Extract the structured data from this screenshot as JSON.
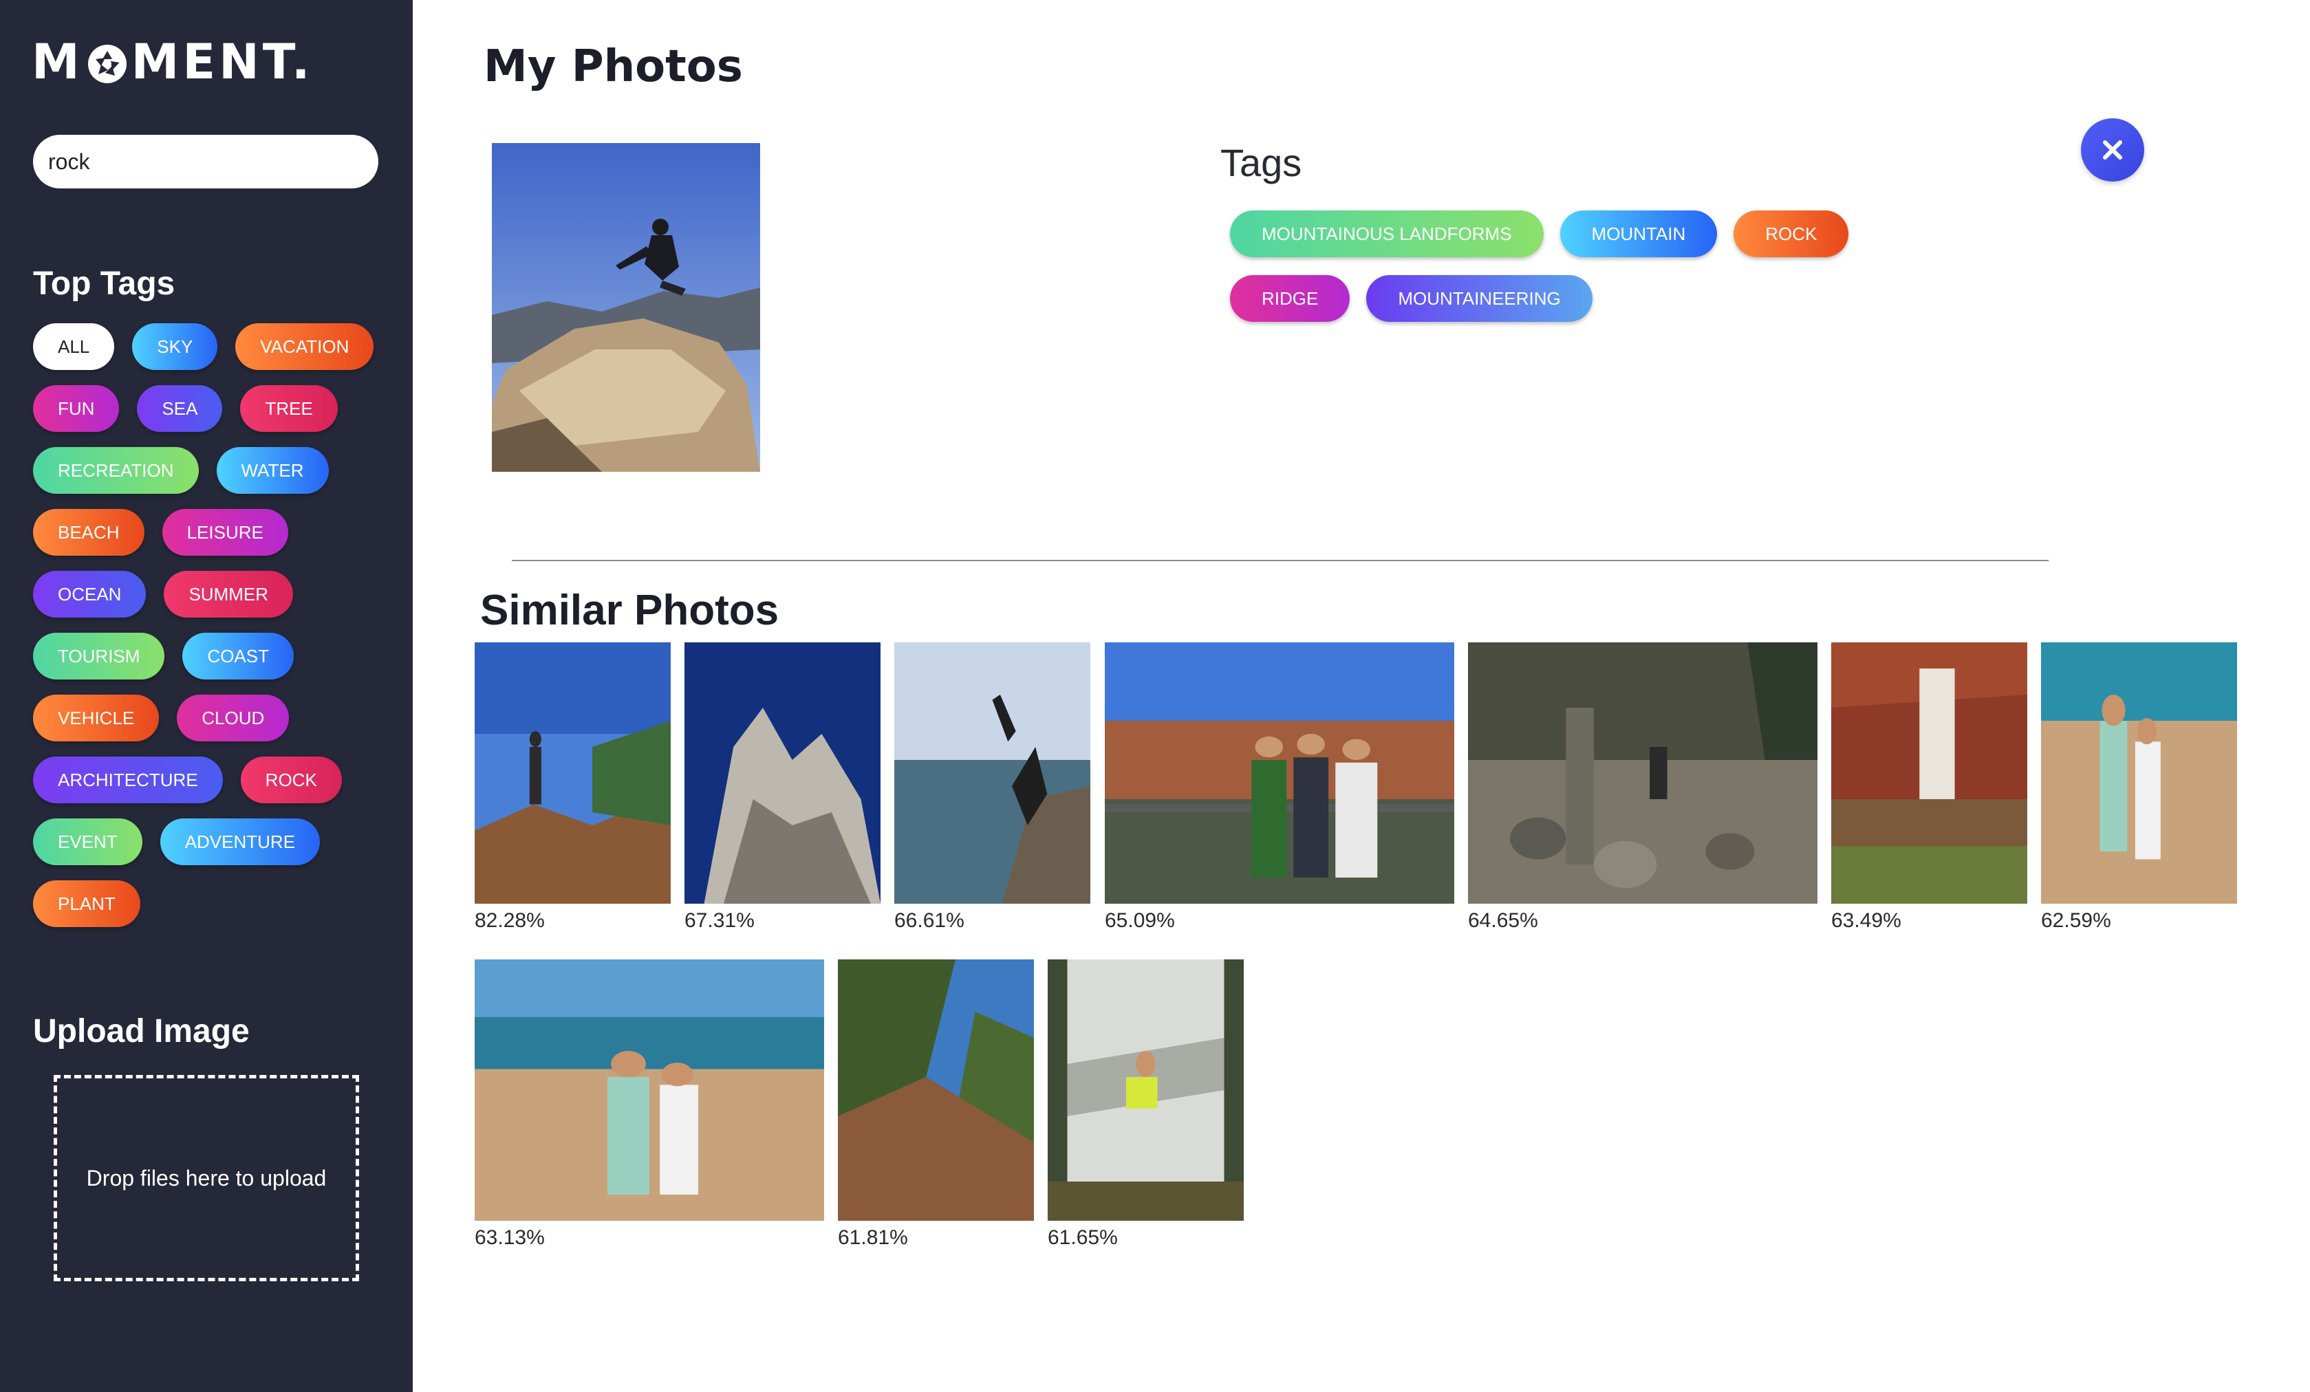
{
  "app": {
    "logo_text_left": "M",
    "logo_text_right": "MENT."
  },
  "search": {
    "value": "rock"
  },
  "sidebar": {
    "top_tags_heading": "Top Tags",
    "tags": [
      {
        "label": "ALL",
        "style": "all"
      },
      {
        "label": "SKY",
        "style": "g-blue"
      },
      {
        "label": "VACATION",
        "style": "g-orange"
      },
      {
        "label": "FUN",
        "style": "g-magenta"
      },
      {
        "label": "SEA",
        "style": "g-purple"
      },
      {
        "label": "TREE",
        "style": "g-red"
      },
      {
        "label": "RECREATION",
        "style": "g-green"
      },
      {
        "label": "WATER",
        "style": "g-blue"
      },
      {
        "label": "BEACH",
        "style": "g-orange"
      },
      {
        "label": "LEISURE",
        "style": "g-magenta"
      },
      {
        "label": "OCEAN",
        "style": "g-purple"
      },
      {
        "label": "SUMMER",
        "style": "g-red"
      },
      {
        "label": "TOURISM",
        "style": "g-green"
      },
      {
        "label": "COAST",
        "style": "g-blue"
      },
      {
        "label": "VEHICLE",
        "style": "g-orange"
      },
      {
        "label": "CLOUD",
        "style": "g-magenta"
      },
      {
        "label": "ARCHITECTURE",
        "style": "g-purple"
      },
      {
        "label": "ROCK",
        "style": "g-red"
      },
      {
        "label": "EVENT",
        "style": "g-green"
      },
      {
        "label": "ADVENTURE",
        "style": "g-blue"
      },
      {
        "label": "PLANT",
        "style": "g-orange"
      }
    ],
    "upload_heading": "Upload Image",
    "dropzone_text": "Drop files here to upload"
  },
  "main": {
    "title": "My Photos",
    "tags_heading": "Tags",
    "photo_tags": [
      {
        "label": "MOUNTAINOUS LANDFORMS",
        "style": "g-green"
      },
      {
        "label": "MOUNTAIN",
        "style": "g-blue"
      },
      {
        "label": "ROCK",
        "style": "g-orange"
      },
      {
        "label": "RIDGE",
        "style": "g-magenta"
      },
      {
        "label": "MOUNTAINEERING",
        "style": "g-purple2"
      }
    ],
    "close_icon": "close-icon",
    "similar_heading": "Similar Photos",
    "similar_photos": [
      {
        "score": "82.28%",
        "scene": "hiker-sky"
      },
      {
        "score": "67.31%",
        "scene": "rock-spire"
      },
      {
        "score": "66.61%",
        "scene": "cliff-sea"
      },
      {
        "score": "65.09%",
        "scene": "canyon-group"
      },
      {
        "score": "64.65%",
        "scene": "stone-cairn"
      },
      {
        "score": "63.49%",
        "scene": "waterfall-red"
      },
      {
        "score": "62.59%",
        "scene": "dune-couple"
      },
      {
        "score": "63.13%",
        "scene": "dune-couple-wide"
      },
      {
        "score": "61.81%",
        "scene": "trail-rocks"
      },
      {
        "score": "61.65%",
        "scene": "waterfall-slide"
      }
    ]
  },
  "colors": {
    "sidebar_bg": "#252838",
    "accent": "#4a55ee",
    "divider": "#8a8a8a"
  }
}
